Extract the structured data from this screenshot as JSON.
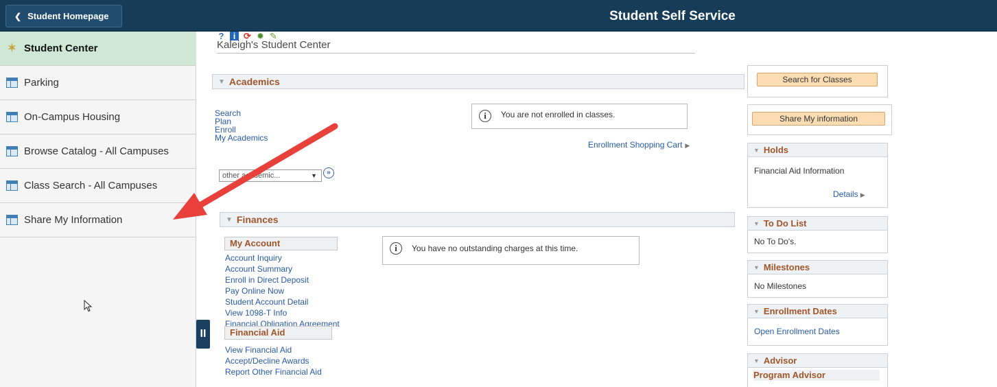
{
  "header": {
    "back_label": "Student Homepage",
    "title": "Student Self Service",
    "color": "#163c58"
  },
  "sidebar": {
    "items": [
      {
        "label": "Student Center",
        "icon": "star-icon",
        "active": true
      },
      {
        "label": "Parking",
        "icon": "table-icon"
      },
      {
        "label": "On-Campus Housing",
        "icon": "table-icon"
      },
      {
        "label": "Browse Catalog - All Campuses",
        "icon": "table-icon"
      },
      {
        "label": "Class Search - All Campuses",
        "icon": "table-icon"
      },
      {
        "label": "Share My Information",
        "icon": "table-icon"
      }
    ],
    "active_color": "#cfe8d6"
  },
  "main": {
    "center_title": "Kaleigh's Student Center",
    "academics": {
      "heading": "Academics",
      "links": [
        "Search",
        "Plan",
        "Enroll",
        "My Academics"
      ],
      "message": "You are not enrolled in classes.",
      "cart_link": "Enrollment Shopping Cart",
      "select_value": "other academic..."
    },
    "finances": {
      "heading": "Finances",
      "my_account_heading": "My Account",
      "my_account_links": [
        "Account Inquiry",
        "Account Summary",
        "Enroll in Direct Deposit",
        "Pay Online Now",
        "Student Account Detail",
        "View 1098-T Info",
        "Financial Obligation Agreement"
      ],
      "financial_aid_heading": "Financial Aid",
      "financial_aid_links": [
        "View Financial Aid",
        "Accept/Decline Awards",
        "Report Other Financial Aid"
      ],
      "message": "You have no outstanding charges at this time."
    }
  },
  "right": {
    "search_classes_button": "Search for Classes",
    "share_info_button": "Share My information",
    "holds": {
      "heading": "Holds",
      "text": "Financial Aid Information",
      "link": "Details"
    },
    "todo": {
      "heading": "To Do List",
      "text": "No To Do's."
    },
    "milestones": {
      "heading": "Milestones",
      "text": "No Milestones"
    },
    "enrollment_dates": {
      "heading": "Enrollment Dates",
      "link": "Open Enrollment Dates"
    },
    "advisor": {
      "heading": "Advisor",
      "sub": "Program Advisor"
    },
    "accent_color": "#a0552a",
    "button_color": "#fbdcb3"
  },
  "annotation": {
    "color": "#e8413c"
  }
}
